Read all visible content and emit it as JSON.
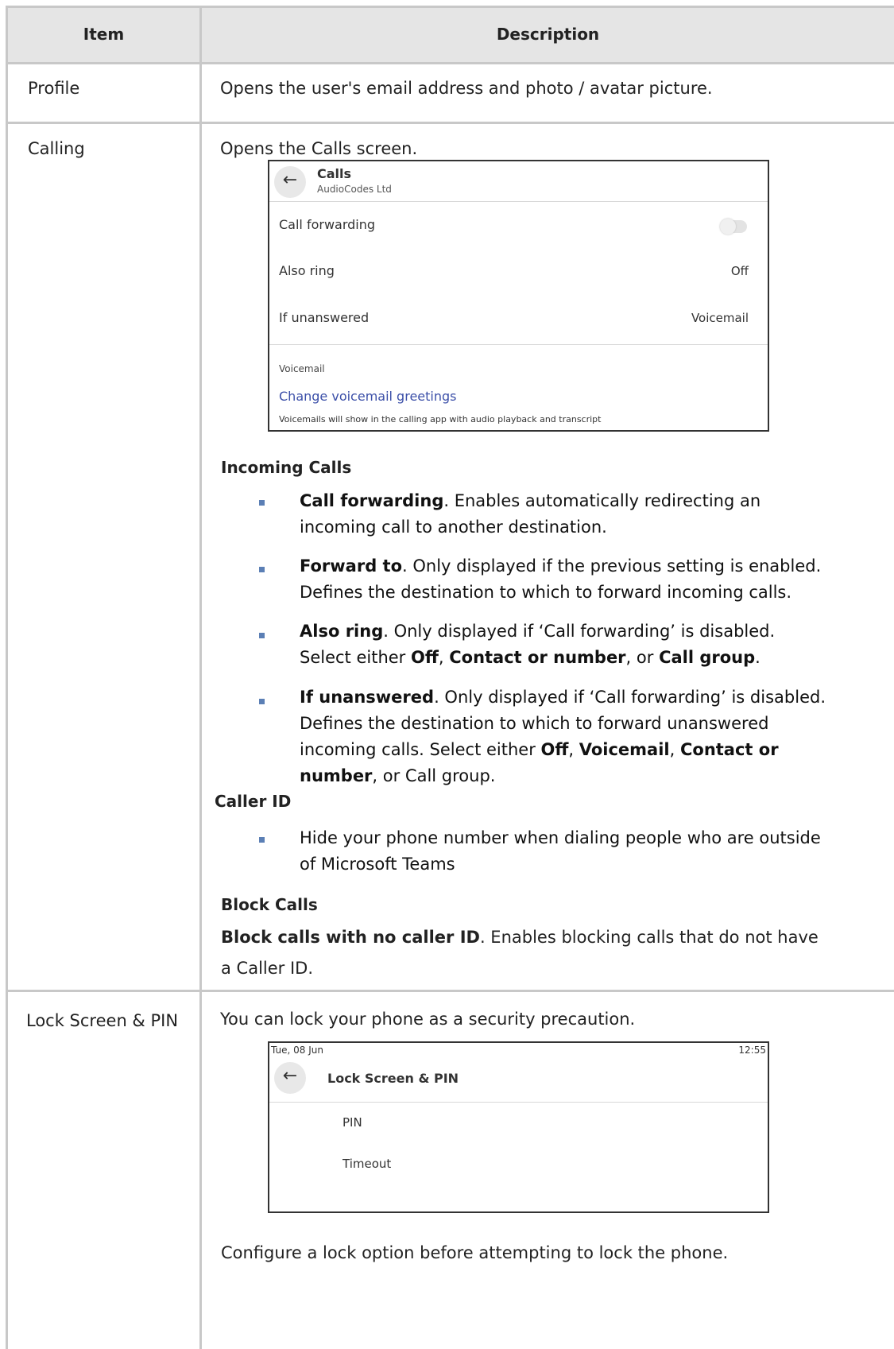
{
  "table": {
    "headers": {
      "item": "Item",
      "description": "Description"
    },
    "rows": {
      "profile": {
        "item": "Profile",
        "description": "Opens the user's email address and photo / avatar picture."
      },
      "calling": {
        "item": "Calling",
        "intro": "Opens the Calls screen.",
        "calls_screen": {
          "title": "Calls",
          "subtitle": "AudioCodes Ltd",
          "call_forwarding_label": "Call forwarding",
          "call_forwarding_on": false,
          "also_ring_label": "Also ring",
          "also_ring_value": "Off",
          "if_unanswered_label": "If unanswered",
          "if_unanswered_value": "Voicemail",
          "voicemail_section": "Voicemail",
          "change_greetings_link": "Change voicemail greetings",
          "voicemail_note": "Voicemails will show in the calling app with audio playback and transcript",
          "link_color": "#3b4fa8"
        },
        "incoming_calls_heading": "Incoming Calls",
        "bullets": [
          {
            "lines": [
              "<b>Call forwarding</b>. Enables automatically redirecting an",
              "incoming call to another destination."
            ]
          },
          {
            "lines": [
              "<b>Forward to</b>. Only displayed if the previous setting is enabled.",
              "Defines the destination to which to forward incoming calls."
            ]
          },
          {
            "lines": [
              "<b>Also ring</b>. Only displayed if ‘Call forwarding’ is disabled.",
              "Select either <b>Off</b>, <b>Contact or number</b>, or <b>Call group</b>."
            ]
          },
          {
            "lines": [
              "<b>If unanswered</b>. Only displayed if ‘Call forwarding’ is disabled.",
              "Defines the destination to which to forward unanswered",
              "incoming calls. Select either <b>Off</b>, <b>Voicemail</b>, <b>Contact or</b>",
              "<b>number</b>, or Call group."
            ]
          }
        ],
        "caller_id_heading": "Caller ID",
        "caller_id_bullet": [
          "Hide your phone number when dialing people who are outside",
          "of Microsoft Teams"
        ],
        "block_calls_heading": "Block Calls",
        "block_calls_bold": "Block calls with no caller ID",
        "block_calls_rest": ". Enables blocking calls that do not have",
        "block_calls_line2": "a Caller ID."
      },
      "lock_screen": {
        "item": "Lock Screen & PIN",
        "intro": "You can lock your phone as a security precaution.",
        "lock_screen_shot": {
          "date": "Tue, 08 Jun",
          "time": "12:55",
          "title": "Lock Screen & PIN",
          "pin_label": "PIN",
          "timeout_label": "Timeout"
        },
        "outro": "Configure a lock option before attempting to lock the phone."
      }
    }
  },
  "colors": {
    "border": "#c8c8c8",
    "header_bg": "#e5e5e5",
    "bullet": "#5b7fb5"
  }
}
